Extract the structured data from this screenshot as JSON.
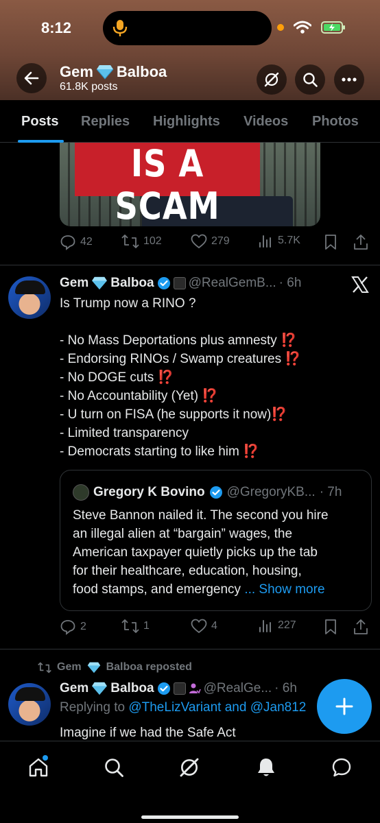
{
  "status_bar": {
    "time": "8:12"
  },
  "profile": {
    "name_first": "Gem",
    "name_last": "Balboa",
    "posts": "61.8K posts"
  },
  "tabs": [
    {
      "label": "Posts",
      "active": true
    },
    {
      "label": "Replies"
    },
    {
      "label": "Highlights"
    },
    {
      "label": "Videos"
    },
    {
      "label": "Photos"
    }
  ],
  "post1": {
    "image_sign_text": "IS A SCAM",
    "replies": "42",
    "reposts": "102",
    "likes": "279",
    "views": "5.7K"
  },
  "post2": {
    "name_first": "Gem",
    "name_last": "Balboa",
    "handle": "@RealGemB...",
    "time": "· 6h",
    "lines": [
      "Is Trump now a RINO ?",
      "",
      "- No Mass Deportations plus amnesty",
      "- Endorsing RINOs / Swamp creatures",
      "- No DOGE cuts",
      "- No Accountability (Yet)",
      "- U turn on FISA (he supports it now)",
      "- Limited transparency",
      "- Democrats starting to like him"
    ],
    "bang": "⁉️",
    "quote": {
      "name": "Gregory K Bovino",
      "handle": "@GregoryKB...",
      "time": "· 7h",
      "lines": [
        "Steve Bannon nailed it.  The second you hire",
        "an illegal alien at “bargain” wages, the",
        "American taxpayer quietly picks up the tab",
        "for their healthcare, education, housing,",
        "food stamps, and emergency"
      ],
      "show_more": "... Show more"
    },
    "replies": "2",
    "reposts": "1",
    "likes": "4",
    "views": "227"
  },
  "post3": {
    "repost_label_first": "Gem",
    "repost_label_last": "Balboa reposted",
    "name_first": "Gem",
    "name_last": "Balboa",
    "handle": "@RealGe...",
    "time": "· 6h",
    "replying_prefix": "Replying to",
    "replying_to": "@TheLizVariant and @Jan812",
    "text": "Imagine if we had the Safe Act"
  },
  "colors": {
    "accent": "#1d9bf0",
    "verified": "#1d9bf0",
    "diamond": "#5bc0eb",
    "bang": "#e0245e"
  }
}
